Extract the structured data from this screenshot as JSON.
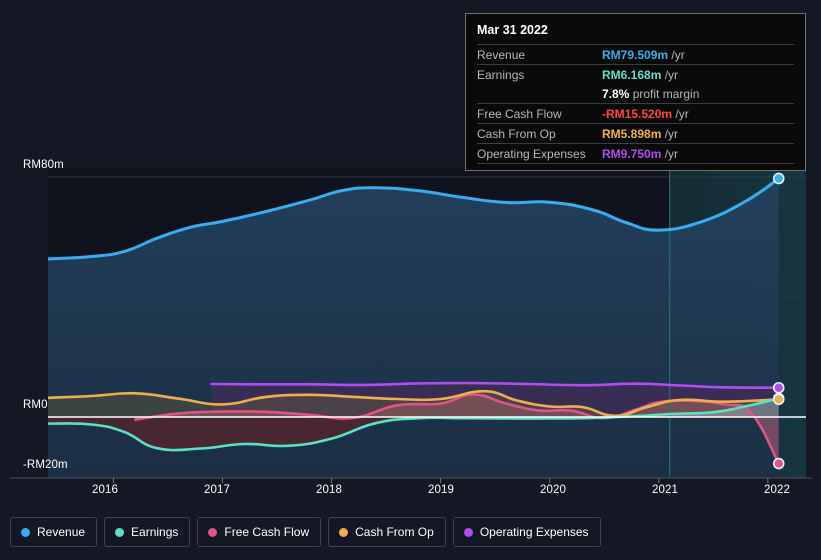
{
  "chart_data": {
    "type": "area",
    "title": "",
    "xlabel": "",
    "ylabel": "",
    "currency": "RM",
    "unit": "m",
    "period": "/yr",
    "grid": true,
    "legend_position": "bottom",
    "xlim": [
      2015.4,
      2022.35
    ],
    "ylim": [
      -20,
      80
    ],
    "x_ticks": [
      "2016",
      "2017",
      "2018",
      "2019",
      "2020",
      "2021",
      "2022"
    ],
    "x_tick_values": [
      2016,
      2017,
      2018,
      2019,
      2020,
      2021,
      2022
    ],
    "y_ticks": [
      "RM80m",
      "RM0",
      "-RM20m"
    ],
    "y_tick_values": [
      80,
      0,
      -20
    ],
    "gridline_values": [
      80,
      40,
      0,
      -20
    ],
    "forecast_divider_x": 2021.1,
    "series": [
      {
        "name": "Revenue",
        "color": "#37aef0",
        "fill": "#1e3552",
        "x": [
          2015.4,
          2015.8,
          2016.1,
          2016.4,
          2016.7,
          2017.0,
          2017.4,
          2017.8,
          2018.1,
          2018.4,
          2018.8,
          2019.2,
          2019.6,
          2020.0,
          2020.4,
          2020.7,
          2021.0,
          2021.4,
          2021.8,
          2022.1
        ],
        "values": [
          52.7,
          53.5,
          55.2,
          59.6,
          63.2,
          65.2,
          68.5,
          72.3,
          75.5,
          76.4,
          75.4,
          73.2,
          71.5,
          71.6,
          69.0,
          64.8,
          62.3,
          65.2,
          72.0,
          79.509
        ],
        "last_value": 79.509
      },
      {
        "name": "Earnings",
        "color": "#5ce0c6",
        "fill": "#4b2733",
        "x": [
          2015.4,
          2015.8,
          2016.1,
          2016.4,
          2016.8,
          2017.2,
          2017.6,
          2018.0,
          2018.4,
          2018.8,
          2019.2,
          2019.6,
          2020.0,
          2020.4,
          2020.8,
          2021.1,
          2021.5,
          2021.8,
          2022.1
        ],
        "values": [
          -2.2,
          -2.5,
          -5.0,
          -10.4,
          -10.5,
          -9.0,
          -9.6,
          -7.2,
          -2.1,
          -0.4,
          -0.4,
          -0.5,
          -0.5,
          -0.3,
          0.3,
          1.0,
          1.6,
          3.6,
          6.168
        ],
        "last_value": 6.168
      },
      {
        "name": "Free Cash Flow",
        "color": "#e0548a",
        "fill": "#8d4f6e",
        "x": [
          2016.2,
          2016.6,
          2017.0,
          2017.4,
          2017.8,
          2018.2,
          2018.6,
          2019.0,
          2019.3,
          2019.6,
          2019.9,
          2020.2,
          2020.5,
          2020.8,
          2021.0,
          2021.3,
          2021.6,
          2021.85,
          2022.1
        ],
        "values": [
          -0.9,
          1.2,
          1.8,
          1.7,
          0.7,
          -0.3,
          3.9,
          4.5,
          7.5,
          4.5,
          2.2,
          2.1,
          -0.4,
          2.6,
          4.9,
          5.4,
          4.2,
          1.2,
          -15.52
        ],
        "last_value": -15.52
      },
      {
        "name": "Cash From Op",
        "color": "#eeb04e",
        "fill": "#6a5a3a",
        "x": [
          2015.4,
          2015.8,
          2016.2,
          2016.6,
          2017.0,
          2017.4,
          2017.8,
          2018.2,
          2018.6,
          2019.0,
          2019.4,
          2019.7,
          2020.0,
          2020.3,
          2020.6,
          2020.9,
          2021.2,
          2021.6,
          2022.1
        ],
        "values": [
          6.4,
          7.0,
          7.9,
          6.1,
          4.2,
          6.7,
          7.4,
          6.7,
          6.0,
          6.0,
          8.6,
          5.5,
          3.5,
          3.3,
          0.4,
          3.4,
          5.7,
          5.1,
          5.898
        ],
        "last_value": 5.898
      },
      {
        "name": "Operating Expenses",
        "color": "#b04cf0",
        "fill": "#3a2d56",
        "x": [
          2016.9,
          2017.3,
          2017.8,
          2018.3,
          2018.8,
          2019.3,
          2019.8,
          2020.3,
          2020.8,
          2021.2,
          2021.6,
          2022.1
        ],
        "values": [
          11.0,
          10.9,
          10.9,
          10.7,
          11.2,
          11.3,
          11.0,
          10.6,
          11.1,
          10.5,
          9.9,
          9.75
        ],
        "last_value": 9.75
      }
    ]
  },
  "tooltip": {
    "date": "Mar 31 2022",
    "rows": [
      {
        "label": "Revenue",
        "value": "RM79.509m",
        "unit": "/yr",
        "color": "#37aef0",
        "rule": true
      },
      {
        "label": "Earnings",
        "value": "RM6.168m",
        "unit": "/yr",
        "color": "#5ce0c6",
        "rule": true
      },
      {
        "label": "",
        "value": "7.8%",
        "unit": "profit margin",
        "color": "#ffffff",
        "rule": false
      },
      {
        "label": "Free Cash Flow",
        "value": "-RM15.520m",
        "unit": "/yr",
        "color": "#ff4343",
        "rule": true
      },
      {
        "label": "Cash From Op",
        "value": "RM5.898m",
        "unit": "/yr",
        "color": "#eeb04e",
        "rule": true
      },
      {
        "label": "Operating Expenses",
        "value": "RM9.750m",
        "unit": "/yr",
        "color": "#b04cf0",
        "rule": true
      }
    ]
  },
  "legend": {
    "items": [
      {
        "label": "Revenue",
        "color": "#37aef0"
      },
      {
        "label": "Earnings",
        "color": "#5ce0c6"
      },
      {
        "label": "Free Cash Flow",
        "color": "#e0548a"
      },
      {
        "label": "Cash From Op",
        "color": "#eeb04e"
      },
      {
        "label": "Operating Expenses",
        "color": "#b04cf0"
      }
    ]
  },
  "axes": {
    "y_labels": [
      {
        "text": "RM80m",
        "value": 80
      },
      {
        "text": "RM0",
        "value": 0
      },
      {
        "text": "-RM20m",
        "value": -20
      }
    ],
    "x_labels": [
      "2016",
      "2017",
      "2018",
      "2019",
      "2020",
      "2021",
      "2022"
    ]
  },
  "colors": {
    "background": "#141824",
    "grid": "#2e3440",
    "axis": "#6e7480",
    "zero_line": "#ffffff",
    "forecast_divider": "#2b6b6b"
  }
}
